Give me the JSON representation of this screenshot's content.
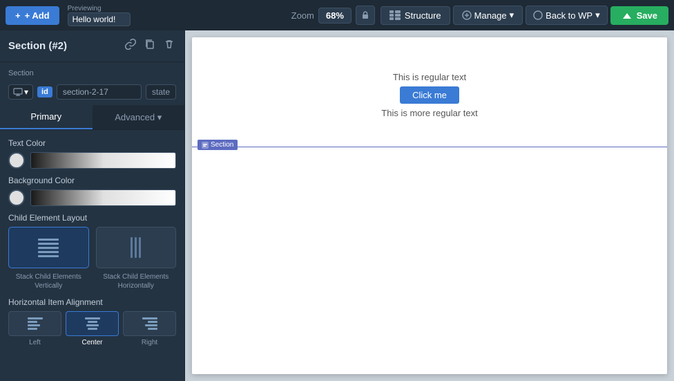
{
  "topbar": {
    "add_label": "+ Add",
    "previewing_label": "Previewing",
    "preview_value": "Hello world!",
    "zoom_label": "Zoom",
    "zoom_value": "68%",
    "structure_label": "Structure",
    "manage_label": "Manage",
    "back_wp_label": "Back to WP",
    "save_label": "Save"
  },
  "panel": {
    "title": "Section (#2)",
    "section_label": "Section",
    "id_badge": "id",
    "id_value": "section-2-17",
    "state_label": "state",
    "tabs": {
      "primary": "Primary",
      "advanced": "Advanced"
    },
    "active_tab": "Primary"
  },
  "properties": {
    "text_color_label": "Text Color",
    "background_color_label": "Background Color",
    "child_layout_label": "Child Element Layout",
    "layout_options": [
      {
        "label": "Stack Child Elements Vertically",
        "active": true
      },
      {
        "label": "Stack Child Elements Horizontally",
        "active": false
      }
    ],
    "alignment_label": "Horizontal Item Alignment",
    "alignment_options": [
      {
        "label": "Left",
        "active": false
      },
      {
        "label": "Center",
        "active": true
      },
      {
        "label": "Right",
        "active": false
      }
    ]
  },
  "canvas": {
    "text1": "This is regular text",
    "button_label": "Click me",
    "text2": "This is more regular text",
    "section_tag": "Section"
  }
}
